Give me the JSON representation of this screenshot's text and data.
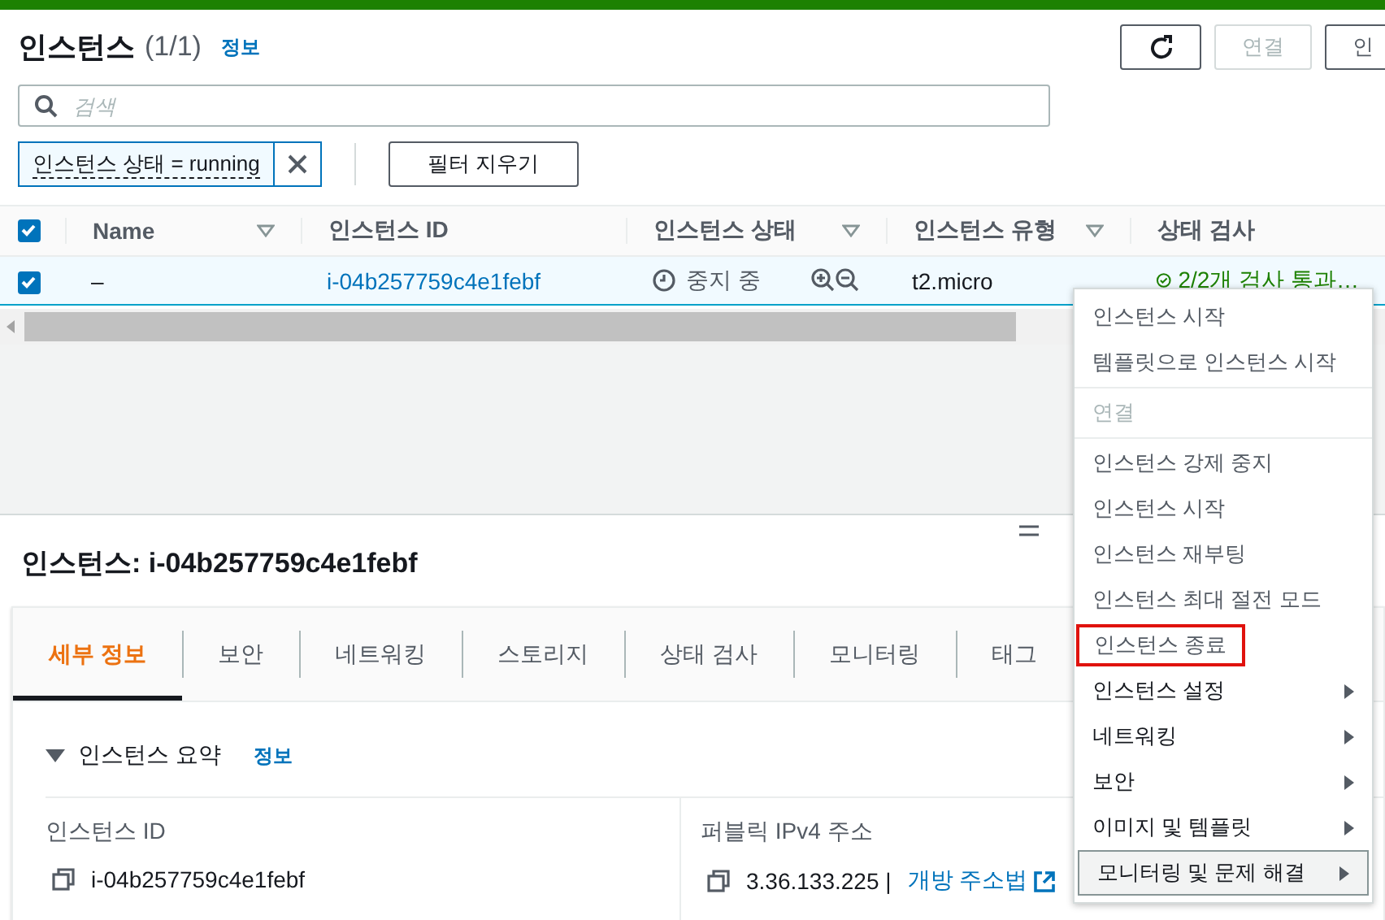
{
  "header": {
    "title": "인스턴스",
    "count": "(1/1)",
    "info": "정보"
  },
  "actions": [
    {
      "kind": "refresh",
      "disabled": false
    },
    {
      "kind": "text",
      "label": "연결",
      "disabled": true
    },
    {
      "kind": "text",
      "label": "인",
      "disabled": false
    }
  ],
  "search": {
    "placeholder": "검색"
  },
  "filter": {
    "token": "인스턴스 상태 = running",
    "clear_button": "필터 지우기"
  },
  "table": {
    "select_all_checked": true,
    "columns": [
      {
        "label": "Name",
        "filterable": true
      },
      {
        "label": "인스턴스 ID",
        "filterable": false
      },
      {
        "label": "인스턴스 상태",
        "filterable": true
      },
      {
        "label": "인스턴스 유형",
        "filterable": true
      },
      {
        "label": "상태 검사",
        "filterable": false
      }
    ],
    "rows": [
      {
        "selected": true,
        "name": "–",
        "instance_id": "i-04b257759c4e1febf",
        "state": "중지 중",
        "type": "t2.micro",
        "status_check": "2/2개 검사 통과…"
      }
    ]
  },
  "details": {
    "title": "인스턴스: i-04b257759c4e1febf",
    "tabs": [
      {
        "label": "세부 정보",
        "selected": true
      },
      {
        "label": "보안",
        "selected": false
      },
      {
        "label": "네트워킹",
        "selected": false
      },
      {
        "label": "스토리지",
        "selected": false
      },
      {
        "label": "상태 검사",
        "selected": false
      },
      {
        "label": "모니터링",
        "selected": false
      },
      {
        "label": "태그",
        "selected": false
      }
    ],
    "section": {
      "title": "인스턴스 요약",
      "info": "정보",
      "expanded": true
    },
    "fields": [
      {
        "label": "인스턴스 ID",
        "value": "i-04b257759c4e1febf"
      },
      {
        "label": "퍼블릭 IPv4 주소",
        "value": "3.36.133.225 |",
        "link": "개방 주소법"
      }
    ]
  },
  "context_menu": {
    "items": [
      {
        "label": "인스턴스 시작",
        "kind": "action",
        "highlighted": false,
        "hovered": false
      },
      {
        "label": "템플릿으로 인스턴스 시작",
        "kind": "action",
        "highlighted": false,
        "hovered": false
      },
      {
        "label": "연결",
        "kind": "disabled",
        "highlighted": false,
        "hovered": false
      },
      {
        "label": "인스턴스 강제 중지",
        "kind": "action",
        "highlighted": false,
        "hovered": false
      },
      {
        "label": "인스턴스 시작",
        "kind": "action",
        "highlighted": false,
        "hovered": false
      },
      {
        "label": "인스턴스 재부팅",
        "kind": "action",
        "highlighted": false,
        "hovered": false
      },
      {
        "label": "인스턴스 최대 절전 모드",
        "kind": "action",
        "highlighted": false,
        "hovered": false
      },
      {
        "label": "인스턴스 종료",
        "kind": "action",
        "highlighted": true,
        "hovered": false
      },
      {
        "label": "인스턴스 설정",
        "kind": "submenu",
        "highlighted": false,
        "hovered": false
      },
      {
        "label": "네트워킹",
        "kind": "submenu",
        "highlighted": false,
        "hovered": false
      },
      {
        "label": "보안",
        "kind": "submenu",
        "highlighted": false,
        "hovered": false
      },
      {
        "label": "이미지 및 템플릿",
        "kind": "submenu",
        "highlighted": false,
        "hovered": false
      },
      {
        "label": "모니터링 및 문제 해결",
        "kind": "submenu",
        "highlighted": false,
        "hovered": true
      }
    ]
  }
}
